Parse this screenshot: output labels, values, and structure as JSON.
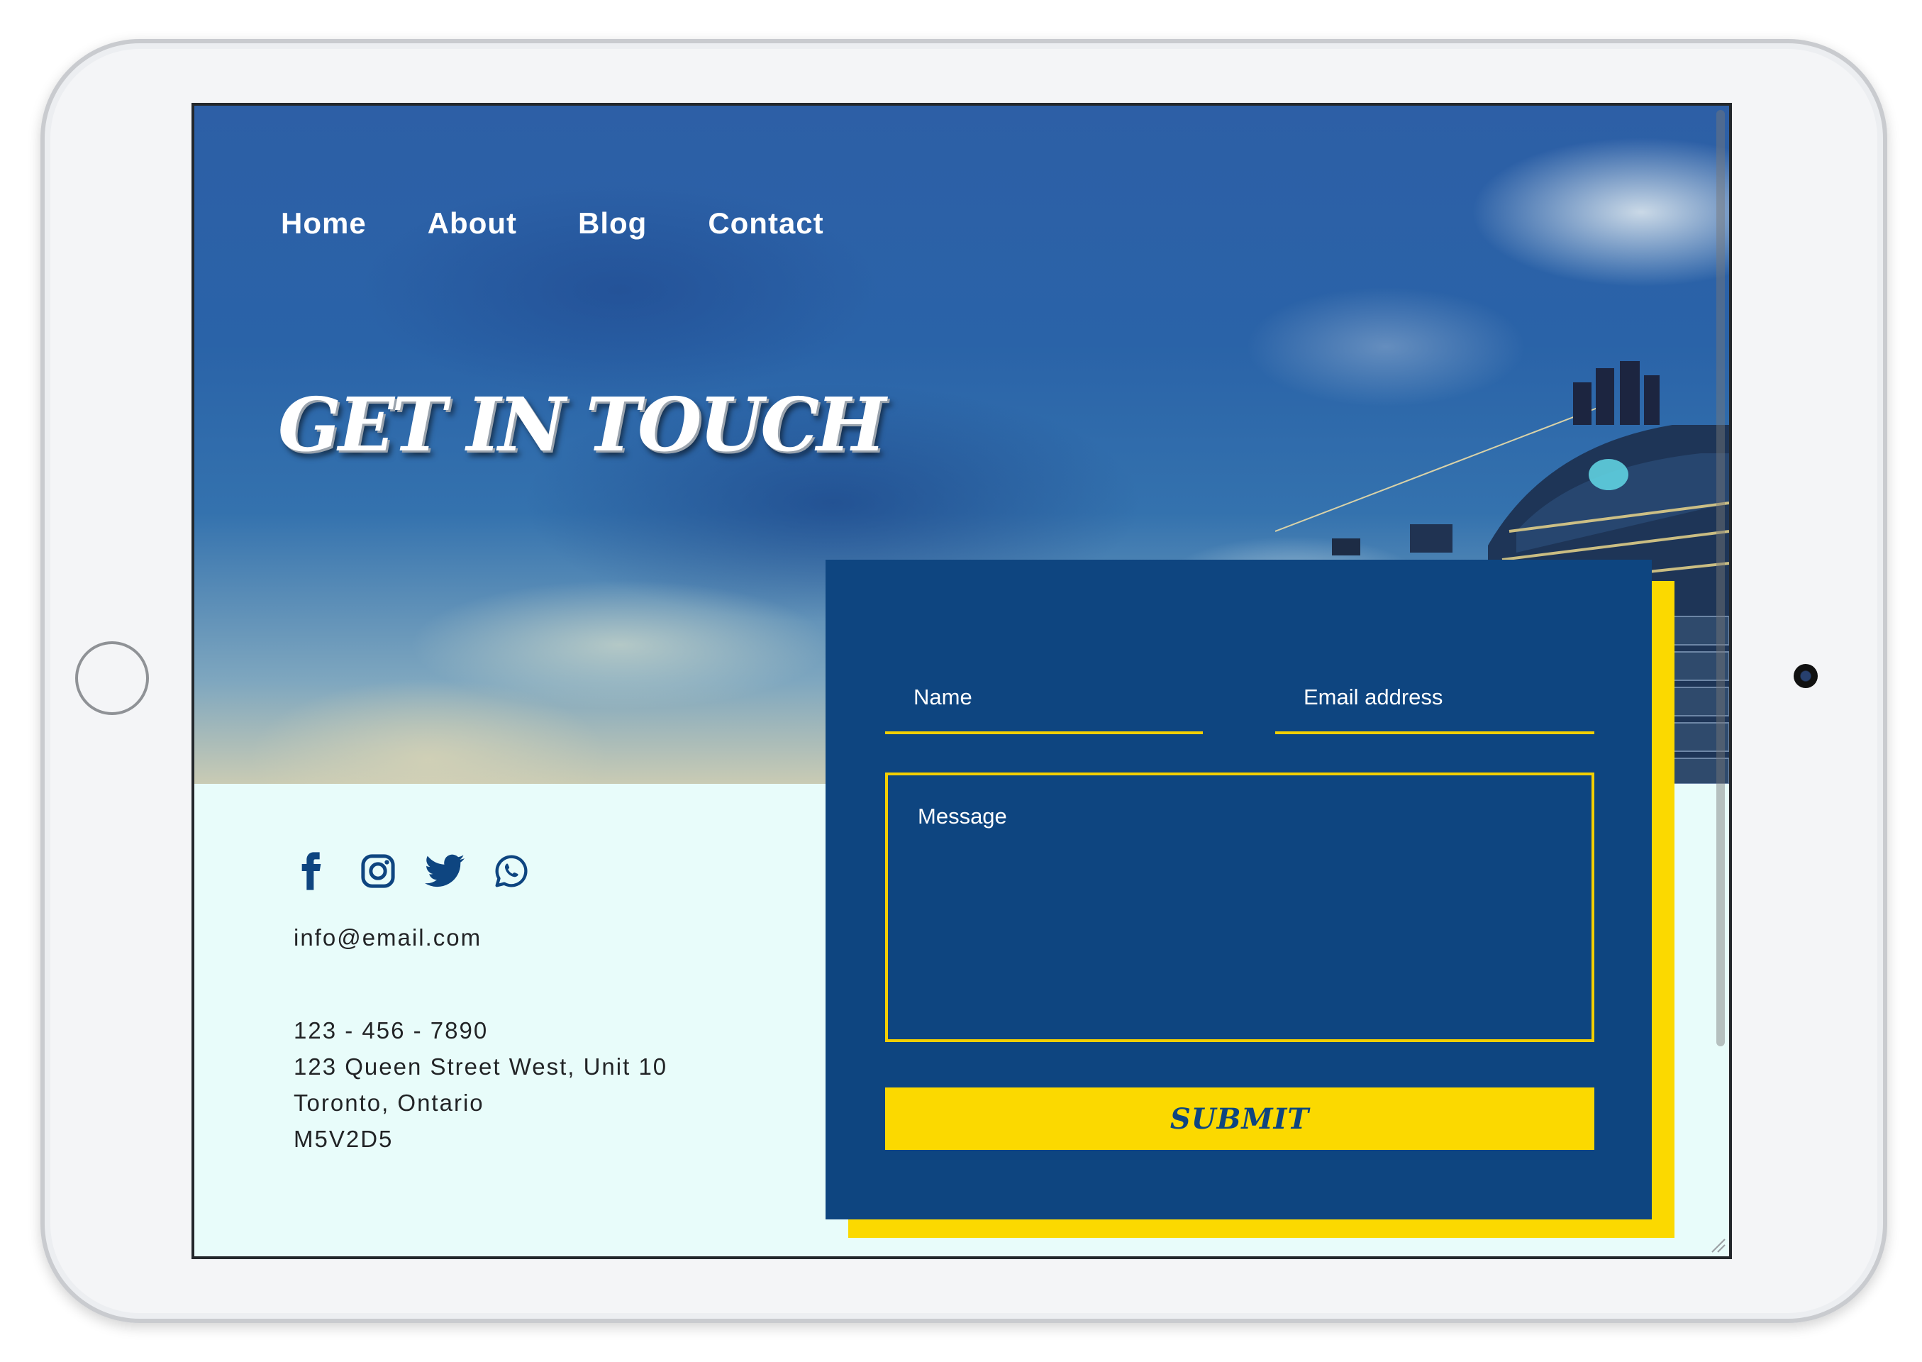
{
  "nav": {
    "items": [
      "Home",
      "About",
      "Blog",
      "Contact"
    ]
  },
  "hero": {
    "title": "GET IN TOUCH"
  },
  "contact": {
    "socials": [
      "facebook-icon",
      "instagram-icon",
      "twitter-icon",
      "whatsapp-icon"
    ],
    "email": "info@email.com",
    "phone": "123 - 456 - 7890",
    "street": "123 Queen Street West, Unit 10",
    "city": "Toronto, Ontario",
    "postal": "M5V2D5"
  },
  "form": {
    "name_label": "Name",
    "email_label": "Email address",
    "message_label": "Message",
    "submit_label": "SUBMIT"
  },
  "colors": {
    "brand_blue": "#0e4580",
    "accent_yellow": "#fbd900",
    "page_bg": "#e8fcfa"
  }
}
